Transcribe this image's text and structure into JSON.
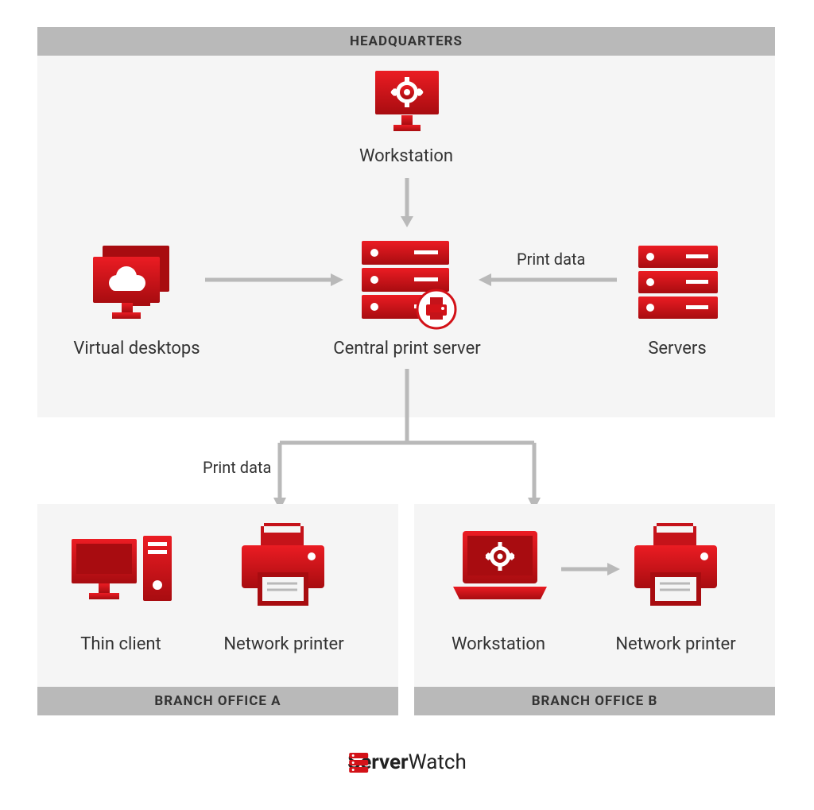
{
  "hq": {
    "title": "HEADQUARTERS",
    "nodes": {
      "workstation": "Workstation",
      "virtual_desktops": "Virtual desktops",
      "central_print_server": "Central print server",
      "servers": "Servers"
    },
    "edge_labels": {
      "server_to_central": "Print data"
    }
  },
  "middle": {
    "edge_labels": {
      "central_to_branches": "Print data"
    }
  },
  "branch_a": {
    "title": "BRANCH OFFICE A",
    "nodes": {
      "thin_client": "Thin client",
      "network_printer": "Network printer"
    }
  },
  "branch_b": {
    "title": "BRANCH OFFICE B",
    "nodes": {
      "workstation": "Workstation",
      "network_printer": "Network printer"
    }
  },
  "brand": {
    "name_bold": "Server",
    "name_reg": "Watch"
  },
  "colors": {
    "red": "#d31218",
    "red_dark": "#a00d10",
    "grey": "#b9b9b9",
    "bg": "#f5f5f5"
  }
}
